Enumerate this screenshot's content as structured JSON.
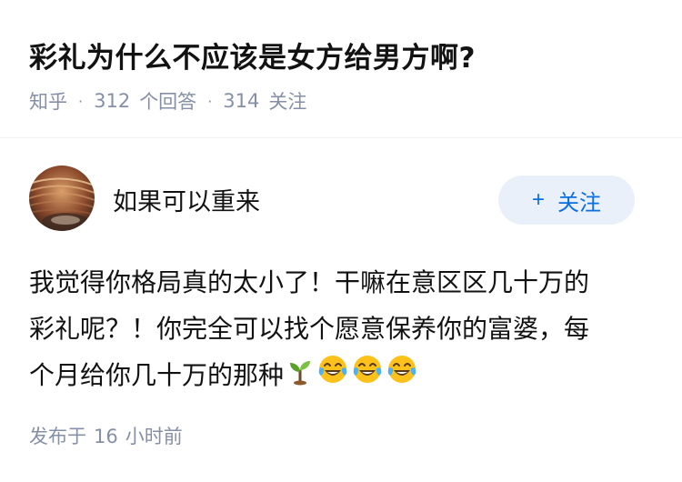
{
  "question": {
    "title": "彩礼为什么不应该是女方给男方啊?",
    "source": "知乎",
    "answers_count": "312",
    "answers_label": "个回答",
    "followers_count": "314",
    "followers_label": "关注"
  },
  "author": {
    "name": "如果可以重来",
    "follow_plus": "+",
    "follow_label": "关注"
  },
  "answer": {
    "line1": "我觉得你格局真的太小了！干嘛在意区区几十万的",
    "line2": "彩礼呢？！你完全可以找个愿意保养你的富婆，每",
    "line3": "个月给你几十万的那种",
    "emojis": [
      "sprout-icon",
      "tears-of-joy-icon",
      "tears-of-joy-icon",
      "tears-of-joy-icon"
    ]
  },
  "publish": {
    "prefix": "发布于",
    "hours": "16",
    "suffix": "小时前"
  },
  "colors": {
    "meta_gray": "#8590a6",
    "follow_bg": "#e9f0fa",
    "follow_text": "#0b6fe0",
    "divider": "#f0f2f7"
  }
}
